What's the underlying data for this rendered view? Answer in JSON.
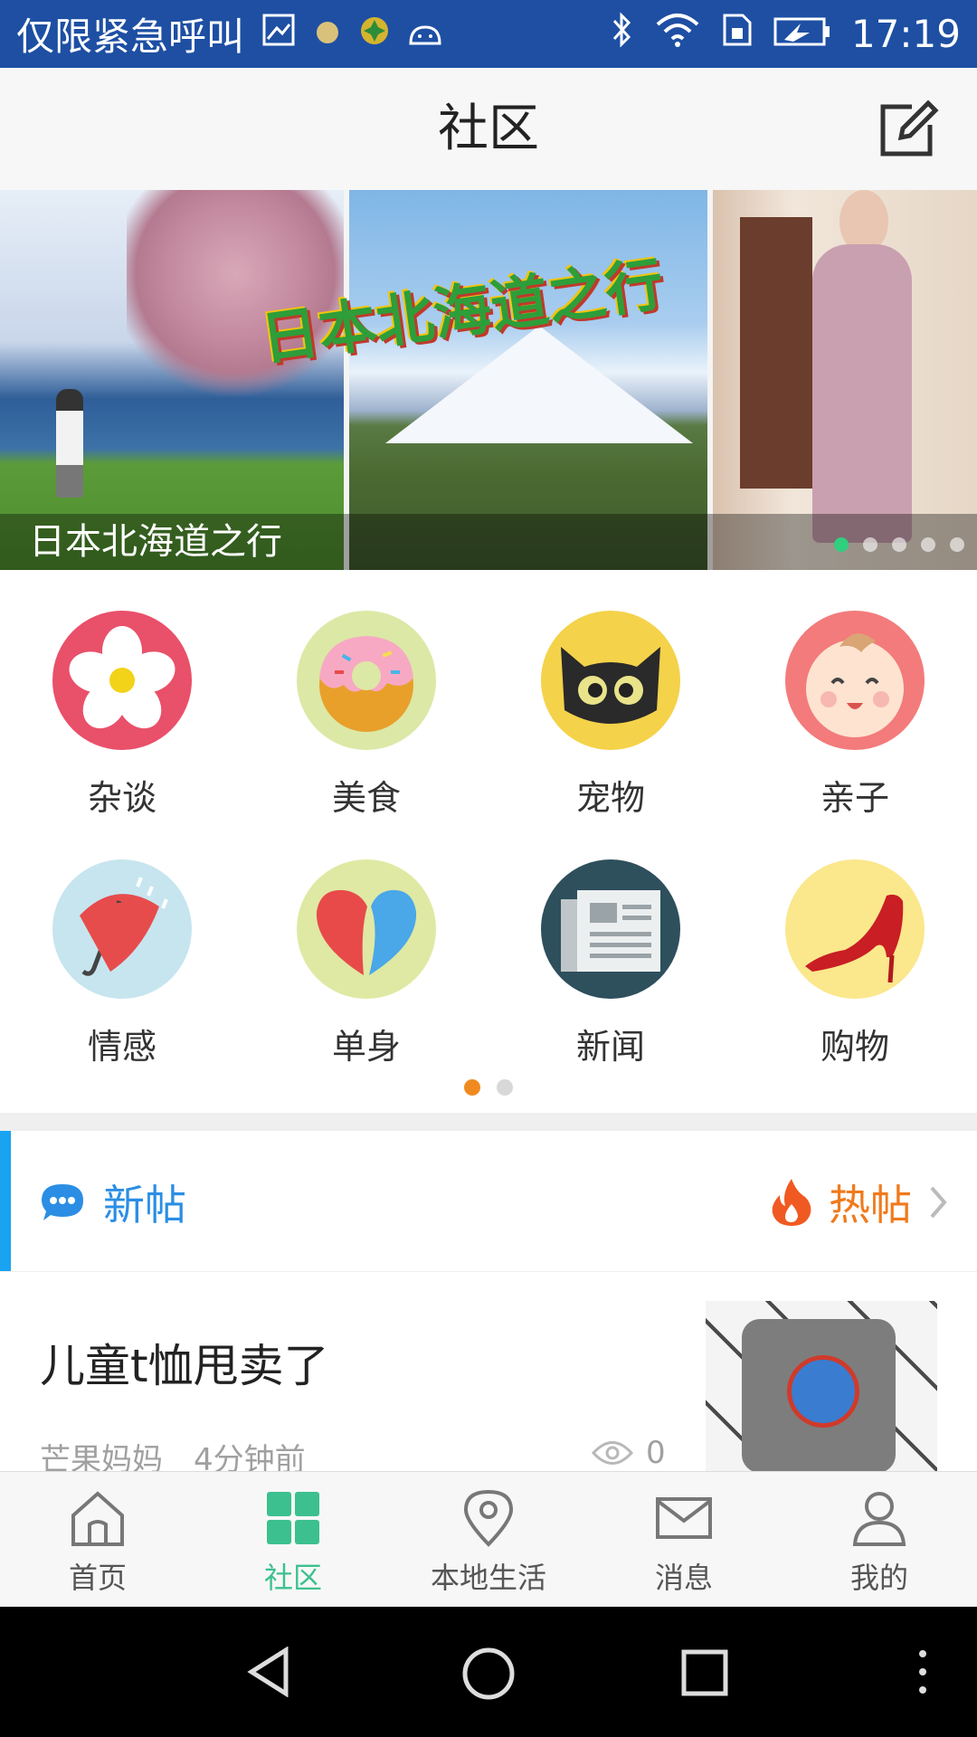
{
  "status_bar": {
    "carrier": "仅限紧急呼叫",
    "time": "17:19",
    "icons": [
      "image-icon",
      "dot-icon",
      "gem-icon",
      "android-icon",
      "bluetooth-icon",
      "wifi-icon",
      "sim-icon",
      "battery-icon"
    ]
  },
  "header": {
    "title": "社区",
    "edit_icon": "edit-icon"
  },
  "banner": {
    "caption": "日本北海道之行",
    "overlay_text": "日本北海道之行",
    "dot_count": 5,
    "active_dot": 0,
    "active_color": "#2fcf7e"
  },
  "categories": [
    {
      "label": "杂谈",
      "icon": "flower-icon",
      "bg": "#e9506a"
    },
    {
      "label": "美食",
      "icon": "donut-icon",
      "bg": "#dce8a6"
    },
    {
      "label": "宠物",
      "icon": "cat-icon",
      "bg": "#f4d24a"
    },
    {
      "label": "亲子",
      "icon": "baby-icon",
      "bg": "#f37b7b"
    },
    {
      "label": "情感",
      "icon": "umbrella-icon",
      "bg": "#c7e5ef"
    },
    {
      "label": "单身",
      "icon": "heart-icon",
      "bg": "#dfe9a3"
    },
    {
      "label": "新闻",
      "icon": "newspaper-icon",
      "bg": "#2e4f5c"
    },
    {
      "label": "购物",
      "icon": "high-heel-icon",
      "bg": "#fbe78c"
    }
  ],
  "category_pages": {
    "count": 2,
    "active": 0,
    "active_color": "#f08a1f"
  },
  "feed_tabs": {
    "new_label": "新帖",
    "hot_label": "热帖",
    "new_color": "#2b8ee4",
    "hot_color": "#f07a1c"
  },
  "posts": [
    {
      "title": "儿童t恤甩卖了",
      "author": "芒果妈妈",
      "time": "4分钟前",
      "views": "0"
    }
  ],
  "bottom_nav": {
    "items": [
      {
        "label": "首页",
        "icon": "home-icon"
      },
      {
        "label": "社区",
        "icon": "community-grid-icon"
      },
      {
        "label": "本地生活",
        "icon": "location-pin-icon"
      },
      {
        "label": "消息",
        "icon": "mail-icon"
      },
      {
        "label": "我的",
        "icon": "person-icon"
      }
    ],
    "active_index": 1,
    "active_color": "#3cc08f"
  },
  "system_nav": [
    "back-icon",
    "home-circle-icon",
    "recents-icon",
    "more-icon"
  ]
}
